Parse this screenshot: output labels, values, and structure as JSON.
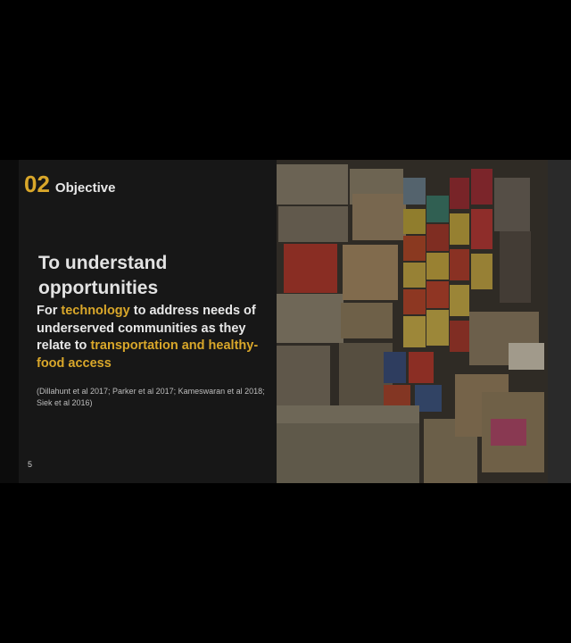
{
  "slide": {
    "section_number": "02",
    "section_title": "Objective",
    "main_title": "To understand opportunities",
    "body": {
      "part1": "For ",
      "highlight1": "technology",
      "part2": " to address needs of underserved communities as they relate to ",
      "highlight2": "transportation and healthy-food access"
    },
    "citation": "(Dillahunt et al 2017; Parker et al 2017; Kameswaran et al 2018; Siek et al 2016)",
    "page_number": "5"
  },
  "colors": {
    "accent": "#d9a72a",
    "panel": "#171717",
    "text": "#e8e8e8"
  }
}
